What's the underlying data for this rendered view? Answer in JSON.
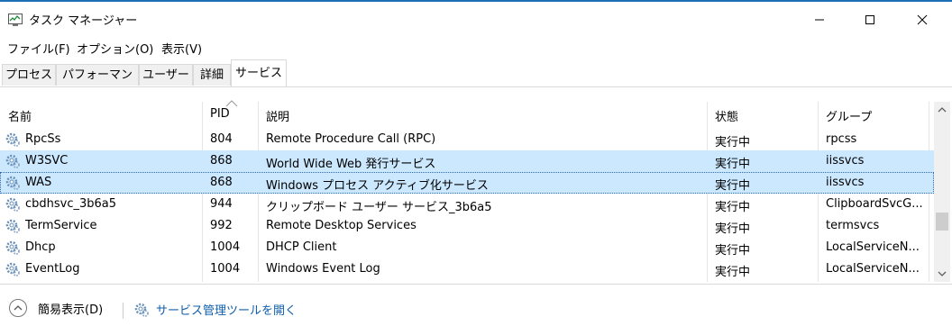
{
  "window": {
    "title": "タスク マネージャー"
  },
  "menu": [
    "ファイル(F)",
    "オプション(O)",
    "表示(V)"
  ],
  "tabs": [
    "プロセス",
    "パフォーマンス",
    "ユーザー",
    "詳細",
    "サービス"
  ],
  "active_tab": "サービス",
  "columns": {
    "name": "名前",
    "pid": "PID",
    "description": "説明",
    "status": "状態",
    "group": "グループ"
  },
  "rows": [
    {
      "name": "RpcSs",
      "pid": "804",
      "description": "Remote Procedure Call (RPC)",
      "status": "実行中",
      "group": "rpcss"
    },
    {
      "name": "W3SVC",
      "pid": "868",
      "description": "World Wide Web 発行サービス",
      "status": "実行中",
      "group": "iissvcs"
    },
    {
      "name": "WAS",
      "pid": "868",
      "description": "Windows プロセス アクティブ化サービス",
      "status": "実行中",
      "group": "iissvcs"
    },
    {
      "name": "cbdhsvc_3b6a5",
      "pid": "944",
      "description": "クリップボード ユーザー サービス_3b6a5",
      "status": "実行中",
      "group": "ClipboardSvcG..."
    },
    {
      "name": "TermService",
      "pid": "992",
      "description": "Remote Desktop Services",
      "status": "実行中",
      "group": "termsvcs"
    },
    {
      "name": "Dhcp",
      "pid": "1004",
      "description": "DHCP Client",
      "status": "実行中",
      "group": "LocalServiceN..."
    },
    {
      "name": "EventLog",
      "pid": "1004",
      "description": "Windows Event Log",
      "status": "実行中",
      "group": "LocalServiceN..."
    }
  ],
  "footer": {
    "fewer_details": "簡易表示(D)",
    "open_services": "サービス管理ツールを開く"
  },
  "colors": {
    "selection": "#cce8ff",
    "link": "#0f5eaa",
    "accent": "#1f6fb4"
  },
  "icons": [
    "task-manager-icon",
    "minimize-icon",
    "maximize-icon",
    "close-icon",
    "service-gear-icon",
    "sort-up-icon",
    "chevron-up-icon"
  ]
}
